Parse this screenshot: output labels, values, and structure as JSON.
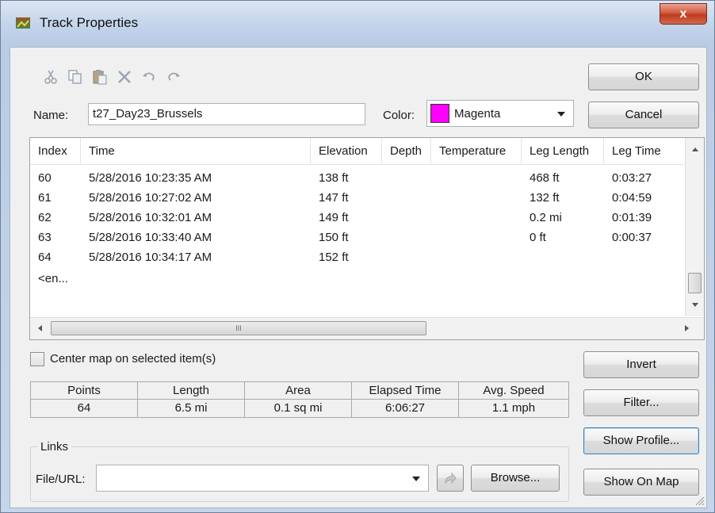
{
  "window": {
    "title": "Track Properties",
    "close_label": "x"
  },
  "toolbar": {
    "icons": [
      "cut-icon",
      "copy-icon",
      "paste-icon",
      "delete-icon",
      "undo-icon",
      "redo-icon"
    ]
  },
  "buttons": {
    "ok": "OK",
    "cancel": "Cancel",
    "invert": "Invert",
    "filter": "Filter...",
    "show_profile": "Show Profile...",
    "show_on_map": "Show On Map",
    "browse": "Browse..."
  },
  "name_field": {
    "label": "Name:",
    "value": "t27_Day23_Brussels"
  },
  "color_field": {
    "label": "Color:",
    "value": "Magenta",
    "swatch": "#ff00ff"
  },
  "table": {
    "columns": [
      "Index",
      "Time",
      "Elevation",
      "Depth",
      "Temperature",
      "Leg Length",
      "Leg Time"
    ],
    "rows": [
      [
        "60",
        "5/28/2016 10:23:35 AM",
        "138 ft",
        "",
        "",
        "468 ft",
        "0:03:27"
      ],
      [
        "61",
        "5/28/2016 10:27:02 AM",
        "147 ft",
        "",
        "",
        "132 ft",
        "0:04:59"
      ],
      [
        "62",
        "5/28/2016 10:32:01 AM",
        "149 ft",
        "",
        "",
        "0.2 mi",
        "0:01:39"
      ],
      [
        "63",
        "5/28/2016 10:33:40 AM",
        "150 ft",
        "",
        "",
        "0 ft",
        "0:00:37"
      ],
      [
        "64",
        "5/28/2016 10:34:17 AM",
        "152 ft",
        "",
        "",
        "",
        ""
      ]
    ],
    "end_row": "<en..."
  },
  "center_map": {
    "label": "Center map on selected item(s)",
    "checked": false
  },
  "stats": {
    "headers": [
      "Points",
      "Length",
      "Area",
      "Elapsed Time",
      "Avg. Speed"
    ],
    "values": [
      "64",
      "6.5 mi",
      "0.1 sq mi",
      "6:06:27",
      "1.1 mph"
    ]
  },
  "links": {
    "group_label": "Links",
    "file_label": "File/URL:",
    "value": ""
  },
  "hscroll_grip": "III"
}
